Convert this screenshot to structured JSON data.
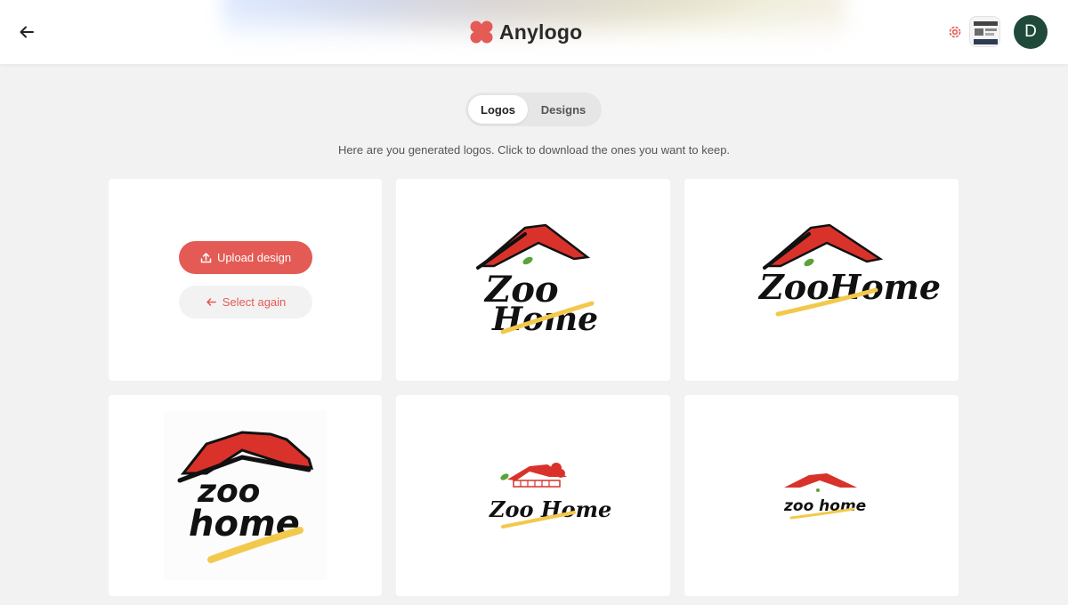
{
  "header": {
    "brand_name": "Anylogo",
    "avatar_initial": "D"
  },
  "tabs": [
    {
      "label": "Logos",
      "active": true
    },
    {
      "label": "Designs",
      "active": false
    }
  ],
  "subtitle": "Here are you generated logos. Click to download the ones you want to keep.",
  "actions": {
    "upload_label": "Upload design",
    "select_again_label": "Select again"
  },
  "logos": [
    {
      "line1": "Zoo",
      "line2": "Home"
    },
    {
      "line1": "ZooHome",
      "line2": ""
    },
    {
      "line1": "zoo",
      "line2": "home"
    },
    {
      "line1": "Zoo Home",
      "line2": ""
    },
    {
      "line1": "zoo home",
      "line2": ""
    }
  ],
  "colors": {
    "accent": "#e45b55",
    "roof_red": "#d9322b",
    "swoosh_yellow": "#f2c94c",
    "avatar_bg": "#1f4a3a"
  }
}
